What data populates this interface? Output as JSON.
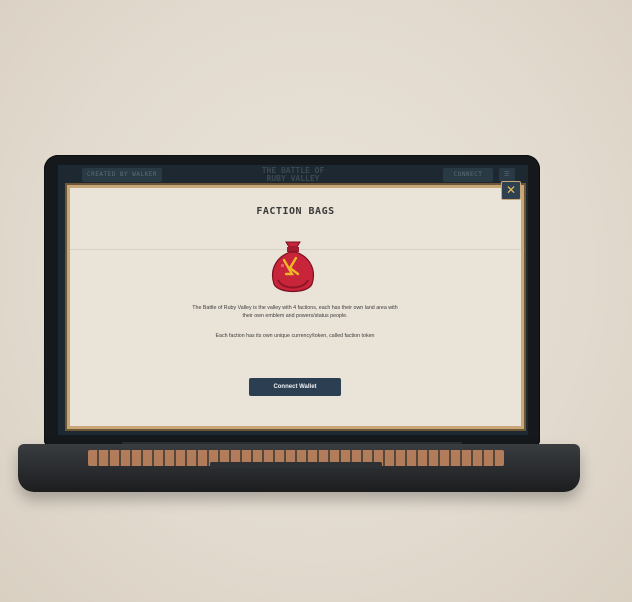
{
  "app_header": {
    "left_button_label": "CREATED BY WALKER",
    "logo_line1": "THE BATTLE OF",
    "logo_line2": "RUBY VALLEY",
    "connect_label": "CONNECT",
    "menu_label": "☰"
  },
  "modal": {
    "title": "FACTION BAGS",
    "description_1": "The Battle of Ruby Valley is the valley with 4 factions, each has their own land area with their own emblem and powers/status people.",
    "description_2": "Each faction has its own unique currency/token, called faction token",
    "connect_button_label": "Connect Wallet",
    "close_label": "✕"
  },
  "icons": {
    "bag": "faction-bag-icon",
    "close": "close-icon"
  },
  "colors": {
    "modal_bg": "#eae4d8",
    "modal_border": "#c7a678",
    "button_bg": "#2c3e52",
    "bag_red": "#c8243a",
    "close_icon": "#e8c05a"
  }
}
